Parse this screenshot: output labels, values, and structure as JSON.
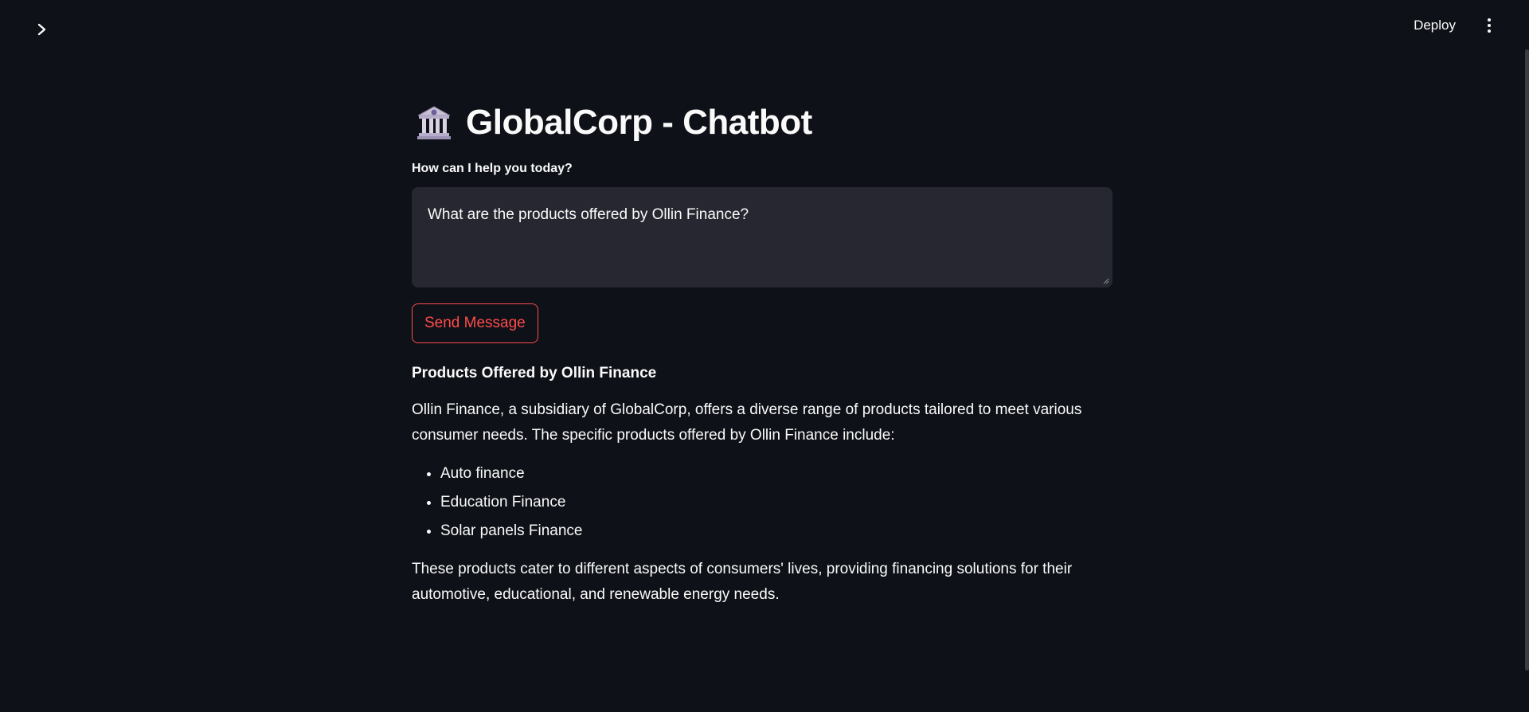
{
  "header": {
    "deploy_label": "Deploy"
  },
  "main": {
    "title": "GlobalCorp - Chatbot",
    "title_icon": "bank-building-emoji",
    "input": {
      "label": "How can I help you today?",
      "value": "What are the products offered by Ollin Finance?"
    },
    "send_button_label": "Send Message",
    "response": {
      "heading": "Products Offered by Ollin Finance",
      "intro": "Ollin Finance, a subsidiary of GlobalCorp, offers a diverse range of products tailored to meet various consumer needs. The specific products offered by Ollin Finance include:",
      "products": [
        "Auto finance",
        "Education Finance",
        "Solar panels Finance"
      ],
      "conclusion": "These products cater to different aspects of consumers' lives, providing financing solutions for their automotive, educational, and renewable energy needs."
    }
  },
  "colors": {
    "background": "#0e1117",
    "input_background": "#262730",
    "accent": "#ff4b4b",
    "text": "#fafafa"
  }
}
